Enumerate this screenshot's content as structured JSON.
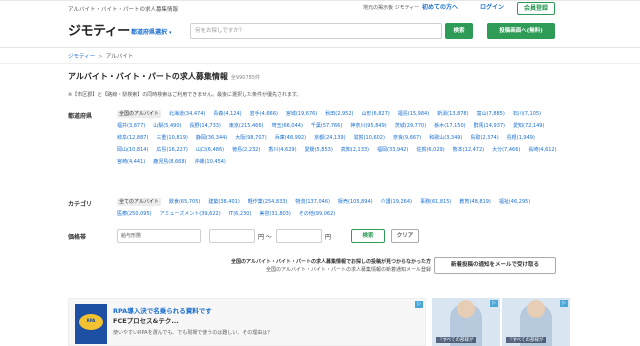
{
  "header": {
    "tagline": "アルバイト・バイト・パートの求人募集情報",
    "logo": "ジモティー",
    "region_selector": "都道府県選択",
    "search_placeholder": "何をお探しですか？",
    "search_button": "検索",
    "post_button": "投稿画面へ(無料)",
    "corp_link": "地元の掲示板 ジモティー",
    "beginner_button": "初めての方へ",
    "login_button": "ログイン",
    "register_button": "会員登録"
  },
  "breadcrumb": {
    "home": "ジモティー",
    "separator": ">",
    "current": "アルバイト"
  },
  "page": {
    "title": "アルバイト・バイト・パートの求人募集情報",
    "count": "全990785件",
    "note": "※【市区郡】と【路線・駅検索】の同時検索はご利用できません。最後に選択した条件が優先されます。"
  },
  "filters": {
    "prefecture_label": "都道府県",
    "prefectures": [
      {
        "name": "全国のアルバイト",
        "count": "",
        "selected": true
      },
      {
        "name": "北海道",
        "count": "(34,474)"
      },
      {
        "name": "青森",
        "count": "(4,124)"
      },
      {
        "name": "岩手",
        "count": "(4,666)"
      },
      {
        "name": "宮城",
        "count": "(19,676)"
      },
      {
        "name": "秋田",
        "count": "(2,952)"
      },
      {
        "name": "山形",
        "count": "(6,827)"
      },
      {
        "name": "福島",
        "count": "(15,984)"
      },
      {
        "name": "新潟",
        "count": "(13,878)"
      },
      {
        "name": "富山",
        "count": "(7,885)"
      },
      {
        "name": "石川",
        "count": "(7,105)"
      },
      {
        "name": "福井",
        "count": "(3,877)"
      },
      {
        "name": "山梨",
        "count": "(5,490)"
      },
      {
        "name": "長野",
        "count": "(14,733)"
      },
      {
        "name": "東京",
        "count": "(215,466)"
      },
      {
        "name": "埼玉",
        "count": "(66,044)"
      },
      {
        "name": "千葉",
        "count": "(57,766)"
      },
      {
        "name": "神奈川",
        "count": "(95,849)"
      },
      {
        "name": "茨城",
        "count": "(29,770)"
      },
      {
        "name": "栃木",
        "count": "(17,150)"
      },
      {
        "name": "群馬",
        "count": "(14,937)"
      },
      {
        "name": "愛知",
        "count": "(72,149)"
      },
      {
        "name": "岐阜",
        "count": "(12,887)"
      },
      {
        "name": "三重",
        "count": "(10,819)"
      },
      {
        "name": "静岡",
        "count": "(36,344)"
      },
      {
        "name": "大阪",
        "count": "(98,707)"
      },
      {
        "name": "兵庫",
        "count": "(48,992)"
      },
      {
        "name": "京都",
        "count": "(24,139)"
      },
      {
        "name": "滋賀",
        "count": "(10,602)"
      },
      {
        "name": "奈良",
        "count": "(9,667)"
      },
      {
        "name": "和歌山",
        "count": "(3,349)"
      },
      {
        "name": "鳥取",
        "count": "(2,374)"
      },
      {
        "name": "島根",
        "count": "(1,949)"
      },
      {
        "name": "岡山",
        "count": "(10,814)"
      },
      {
        "name": "広島",
        "count": "(16,227)"
      },
      {
        "name": "山口",
        "count": "(6,486)"
      },
      {
        "name": "徳島",
        "count": "(2,232)"
      },
      {
        "name": "香川",
        "count": "(4,629)"
      },
      {
        "name": "愛媛",
        "count": "(5,853)"
      },
      {
        "name": "高知",
        "count": "(2,133)"
      },
      {
        "name": "福岡",
        "count": "(33,942)"
      },
      {
        "name": "佐賀",
        "count": "(6,029)"
      },
      {
        "name": "熊本",
        "count": "(12,472)"
      },
      {
        "name": "大分",
        "count": "(7,466)"
      },
      {
        "name": "長崎",
        "count": "(4,612)"
      },
      {
        "name": "宮崎",
        "count": "(4,441)"
      },
      {
        "name": "鹿児島",
        "count": "(8,668)"
      },
      {
        "name": "沖縄",
        "count": "(10,454)"
      }
    ],
    "category_label": "カテゴリ",
    "categories": [
      {
        "name": "全てのアルバイト",
        "count": "",
        "selected": true
      },
      {
        "name": "飲食",
        "count": "(65,705)"
      },
      {
        "name": "建築",
        "count": "(38,401)"
      },
      {
        "name": "軽作業",
        "count": "(254,833)"
      },
      {
        "name": "物流",
        "count": "(137,046)"
      },
      {
        "name": "販売",
        "count": "(105,894)"
      },
      {
        "name": "介護",
        "count": "(19,264)"
      },
      {
        "name": "事務",
        "count": "(61,815)"
      },
      {
        "name": "教育",
        "count": "(48,819)"
      },
      {
        "name": "福祉",
        "count": "(46,295)"
      },
      {
        "name": "医療",
        "count": "(250,095)"
      },
      {
        "name": "アミューズメント",
        "count": "(39,622)"
      },
      {
        "name": "IT",
        "count": "(6,230)"
      },
      {
        "name": "美容",
        "count": "(31,803)"
      },
      {
        "name": "その他",
        "count": "(99,062)"
      }
    ],
    "price_label": "価格帯",
    "price_select": "給与形態",
    "price_unit_from": "円 〜",
    "price_unit_to": "円",
    "apply_button": "検索",
    "clear_button": "クリア"
  },
  "notification": {
    "line1": "全国のアルバイト・バイト・パートの求人募集情報でお探しの投稿が見つからなかった方",
    "line2": "全国のアルバイト・バイト・パートの求人募集情報の新着通知メール登録",
    "button": "新着投稿の通知をメールで受け取る"
  },
  "ad": {
    "title1": "RPA導入決で名乗られる資料です",
    "title2": "FCEプロセス&テク...",
    "desc": "使いやすいRPAを選んでも、でも現場で使うのは難しい、その理由は？",
    "badge": "RPA",
    "mark": "▷",
    "side_caption": "『すべての部様が",
    "side_mark": "▷"
  },
  "colors": {
    "accent_green": "#2e9b57",
    "link_blue": "#1a6fd1"
  }
}
